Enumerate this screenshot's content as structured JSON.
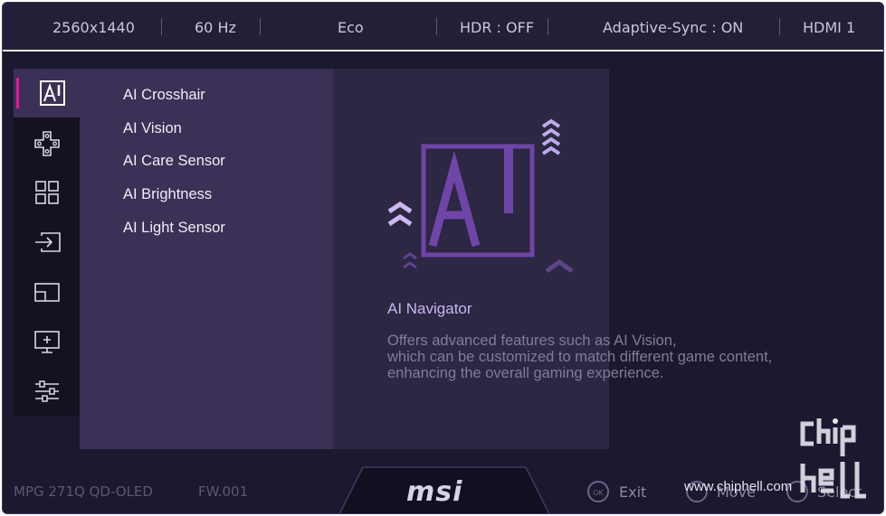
{
  "status_bar": {
    "resolution": "2560x1440",
    "refresh_rate": "60 Hz",
    "mode": "Eco",
    "hdr": "HDR : OFF",
    "adaptive_sync": "Adaptive-Sync : ON",
    "input": "HDMI 1"
  },
  "sidebar": {
    "items": [
      {
        "icon": "ai-navigator-icon",
        "active": true
      },
      {
        "icon": "gaming-controller-icon",
        "active": false
      },
      {
        "icon": "professional-grid-icon",
        "active": false
      },
      {
        "icon": "input-source-icon",
        "active": false
      },
      {
        "icon": "pip-pbp-icon",
        "active": false
      },
      {
        "icon": "navi-key-icon",
        "active": false
      },
      {
        "icon": "settings-sliders-icon",
        "active": false
      }
    ]
  },
  "submenu": {
    "items": [
      "AI Crosshair",
      "AI Vision",
      "AI Care Sensor",
      "AI Brightness",
      "AI Light Sensor"
    ]
  },
  "description": {
    "title": "AI Navigator",
    "line1": "Offers advanced features such as AI Vision,",
    "line2": "which can be customized to match different game content,",
    "line3": "enhancing the overall gaming experience."
  },
  "footer": {
    "model": "MPG 271Q QD-OLED",
    "firmware": "FW.001",
    "brand": "msi",
    "exit_label": "Exit",
    "move_label": "Move",
    "select_label": "Select"
  },
  "watermark": {
    "url": "www.chiphell.com",
    "logo_text": "chip hell"
  },
  "colors": {
    "accent": "#e8189a",
    "ai_graphic": "#7d4fb8",
    "title": "#c7b7f2"
  }
}
